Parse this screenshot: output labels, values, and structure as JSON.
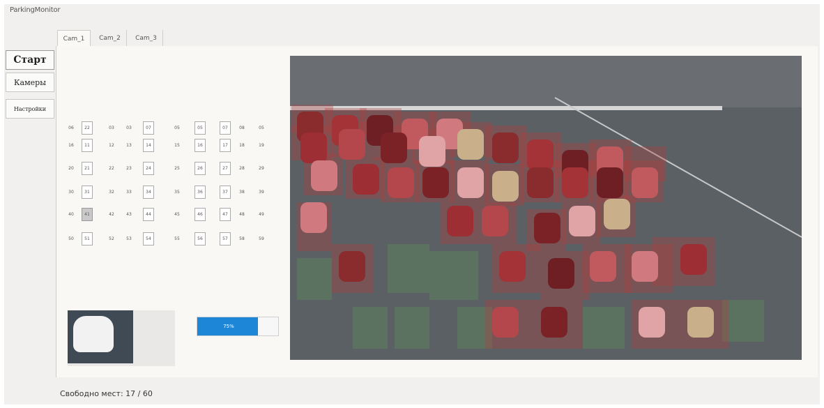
{
  "window": {
    "title": "ParkingMonitor"
  },
  "sidebar": {
    "buttons": [
      {
        "label": "Старт"
      },
      {
        "label": "Камеры"
      },
      {
        "label": "Настройки"
      }
    ]
  },
  "tabs": [
    {
      "label": "Cam_1"
    },
    {
      "label": "Cam_2"
    },
    {
      "label": "Cam_3"
    }
  ],
  "grid": {
    "rows": [
      [
        "06",
        "22",
        "03",
        "03",
        "07",
        "05",
        "05",
        "07",
        "08",
        "05"
      ],
      [
        "16",
        "11",
        "12",
        "13",
        "14",
        "15",
        "16",
        "17",
        "18",
        "19"
      ],
      [
        "20",
        "21",
        "22",
        "23",
        "24",
        "25",
        "26",
        "27",
        "28",
        "29"
      ],
      [
        "30",
        "31",
        "32",
        "33",
        "34",
        "35",
        "36",
        "37",
        "38",
        "39"
      ],
      [
        "40",
        "41",
        "42",
        "43",
        "44",
        "45",
        "46",
        "47",
        "48",
        "49"
      ],
      [
        "50",
        "51",
        "52",
        "53",
        "54",
        "55",
        "56",
        "57",
        "58",
        "59"
      ]
    ]
  },
  "progress": {
    "value": 0.75,
    "label": "75%"
  },
  "status": {
    "text": "Свободно мест: 17 / 60"
  }
}
